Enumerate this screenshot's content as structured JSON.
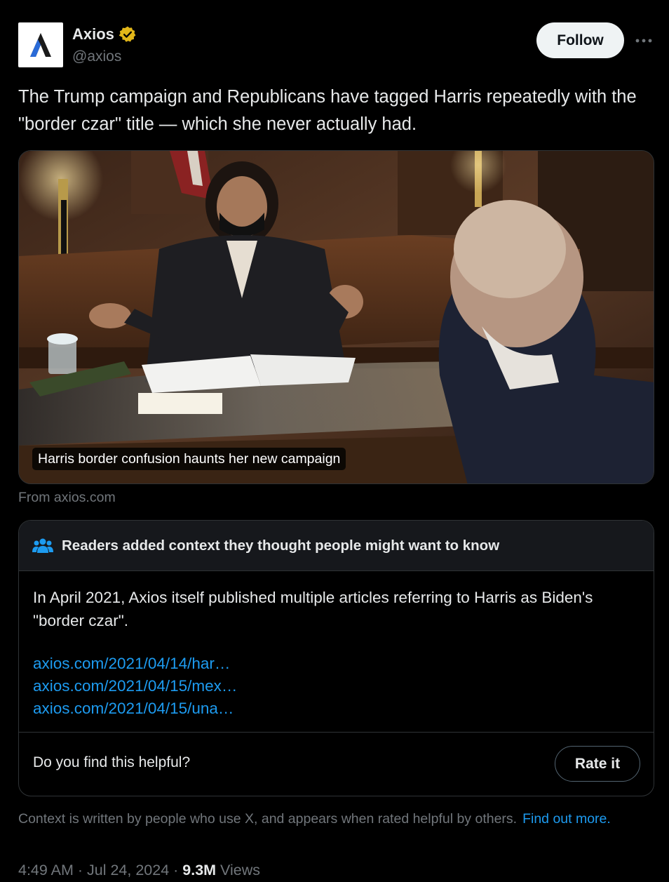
{
  "author": {
    "name": "Axios",
    "handle": "@axios",
    "verified_badge": "gold-verified-badge-icon",
    "logo_letter": "Λ"
  },
  "actions": {
    "follow_label": "Follow",
    "more_icon": "more-options-icon"
  },
  "tweet": {
    "text": "The Trump campaign and Republicans have tagged Harris repeatedly with the \"border czar\" title — which she never actually had."
  },
  "media": {
    "caption": "Harris border confusion haunts her new campaign",
    "source": "From axios.com"
  },
  "community_note": {
    "icon": "people-icon",
    "title": "Readers added context they thought people might want to know",
    "body": "In April 2021, Axios itself published multiple articles referring to Harris as Biden's \"border czar\".",
    "links": [
      "axios.com/2021/04/14/har…",
      "axios.com/2021/04/15/mex…",
      "axios.com/2021/04/15/una…"
    ],
    "helpful_question": "Do you find this helpful?",
    "rate_label": "Rate it"
  },
  "context_footer": {
    "text": "Context is written by people who use X, and appears when rated helpful by others.",
    "link": "Find out more."
  },
  "meta": {
    "time": "4:49 AM",
    "sep1": " · ",
    "date": "Jul 24, 2024",
    "sep2": " · ",
    "views_count": "9.3M",
    "views_label": " Views"
  },
  "colors": {
    "background": "#000000",
    "text": "#e7e9ea",
    "muted": "#71767b",
    "link": "#1d9bf0",
    "border": "#2f3336",
    "verified_gold": "#e2b719"
  }
}
